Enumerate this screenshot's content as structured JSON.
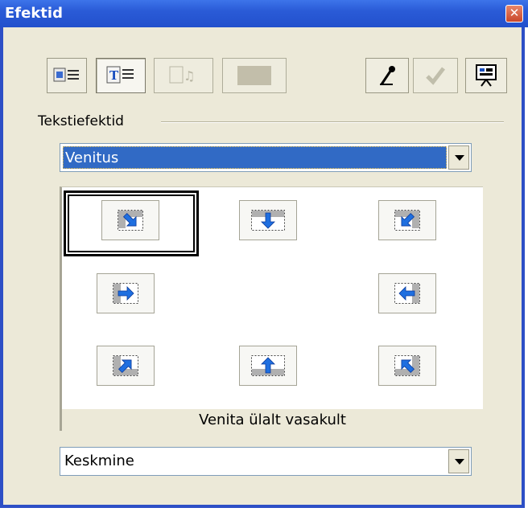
{
  "window": {
    "title": "Efektid",
    "close_glyph": "✕"
  },
  "toolbar": [
    {
      "name": "slide-effects-button",
      "icon": "slide-effects-icon",
      "state": "normal"
    },
    {
      "name": "text-effects-button",
      "icon": "text-effects-icon",
      "state": "pressed"
    },
    {
      "name": "sound-effects-button",
      "icon": "sound-effects-icon",
      "state": "disabled"
    },
    {
      "name": "blank-effects-button",
      "icon": "blank-icon",
      "state": "disabled"
    },
    {
      "name": "extras-button",
      "icon": "microphone-icon",
      "state": "normal"
    },
    {
      "name": "assign-button",
      "icon": "checkmark-icon",
      "state": "disabled"
    },
    {
      "name": "preview-button",
      "icon": "presentation-icon",
      "state": "normal"
    }
  ],
  "group": {
    "label": "Tekstiefektid"
  },
  "effect_category": {
    "value": "Venitus"
  },
  "effects": [
    {
      "name": "stretch-from-top-left",
      "arrow": "se",
      "selected": true
    },
    {
      "name": "stretch-from-top",
      "arrow": "s",
      "selected": false
    },
    {
      "name": "stretch-from-top-right",
      "arrow": "sw",
      "selected": false
    },
    {
      "name": "stretch-from-left",
      "arrow": "e",
      "selected": false
    },
    {
      "name": "stretch-from-right",
      "arrow": "w",
      "selected": false
    },
    {
      "name": "stretch-from-bottom-left",
      "arrow": "ne",
      "selected": false
    },
    {
      "name": "stretch-from-bottom",
      "arrow": "n",
      "selected": false
    },
    {
      "name": "stretch-from-bottom-right",
      "arrow": "nw",
      "selected": false
    }
  ],
  "status": {
    "text": "Venita ülalt vasakult"
  },
  "speed": {
    "value": "Keskmine"
  },
  "colors": {
    "title_bar": "#2a5bd7",
    "face": "#ece9d8",
    "selection": "#316ac5",
    "arrow_blue": "#1f6fe0"
  }
}
